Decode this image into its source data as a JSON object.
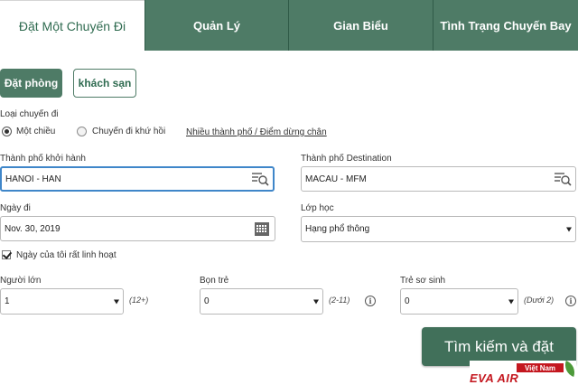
{
  "tabs": [
    {
      "label": "Đặt Một Chuyến Đi",
      "active": true
    },
    {
      "label": "Quản Lý",
      "active": false
    },
    {
      "label": "Gian Biểu",
      "active": false
    },
    {
      "label": "Tình Trạng Chuyến Bay",
      "active": false
    }
  ],
  "booking": {
    "book_label": "Đặt phòng",
    "hotel_label": "khách sạn"
  },
  "trip_type": {
    "label": "Loại chuyến đi",
    "one_way": "Một chiều",
    "round_trip": "Chuyến đi khứ hồi",
    "multi_city_link": "Nhiều thành phố / Điểm dừng chân",
    "selected": "one_way"
  },
  "origin": {
    "label": "Thành phố khởi hành",
    "value": "HANOI - HAN",
    "icon": "search-list-icon"
  },
  "destination": {
    "label": "Thành phố Destination",
    "value": "MACAU - MFM",
    "icon": "search-list-icon"
  },
  "date": {
    "label": "Ngày đi",
    "value": "Nov. 30, 2019",
    "icon": "calendar-icon"
  },
  "cabin": {
    "label": "Lớp học",
    "value": "Hạng phổ thông"
  },
  "flexible": {
    "label": "Ngày của tôi rất linh hoạt",
    "checked": true
  },
  "passengers": {
    "adults": {
      "label": "Người lớn",
      "value": "1",
      "hint": "(12+)"
    },
    "children": {
      "label": "Bọn trẻ",
      "value": "0",
      "hint": "(2-11)"
    },
    "infants": {
      "label": "Trẻ sơ sinh",
      "value": "0",
      "hint": "(Dưới 2)"
    }
  },
  "info_glyph": "i",
  "search_button": "Tìm kiếm và đặt",
  "watermark": {
    "top": "Việt Nam",
    "bottom": "EVA AIR"
  },
  "colors": {
    "tab_green": "#4e7b66",
    "button_green": "#41705a",
    "focus_blue": "#3f86c9",
    "watermark_red": "#c4171f"
  }
}
